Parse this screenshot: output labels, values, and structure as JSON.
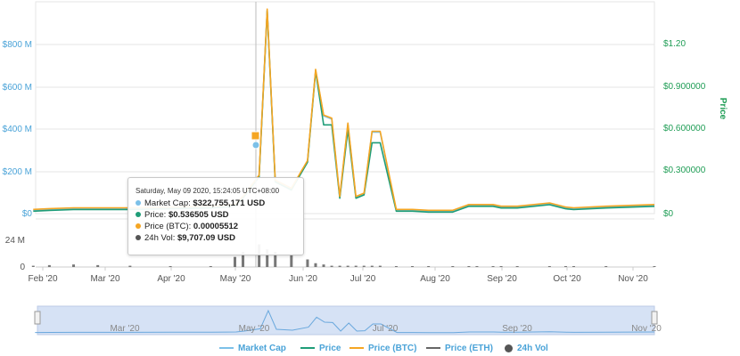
{
  "chart_data": {
    "type": "line",
    "title": "",
    "y_left": {
      "ticks": [
        "$0",
        "$200 M",
        "$400 M",
        "$600 M",
        "$800 M"
      ],
      "values": [
        0,
        200000000,
        400000000,
        600000000,
        800000000
      ]
    },
    "y_right": {
      "label": "Price",
      "ticks": [
        "$0",
        "$0.300000",
        "$0.600000",
        "$0.900000",
        "$1.20"
      ],
      "values": [
        0,
        0.3,
        0.6,
        0.9,
        1.2
      ]
    },
    "y_volume": {
      "ticks": [
        "0",
        "24 M"
      ],
      "values": [
        0,
        24000000
      ]
    },
    "x_ticks": [
      "Feb '20",
      "Mar '20",
      "Apr '20",
      "May '20",
      "Jun '20",
      "Jul '20",
      "Aug '20",
      "Sep '20",
      "Oct '20",
      "Nov '20"
    ],
    "navigator_ticks": [
      "Mar '20",
      "May '20",
      "Jul '20",
      "Sep '20",
      "Nov '20"
    ],
    "grid": true,
    "legend_position": "bottom",
    "colors": {
      "market_cap": "#7cc0e8",
      "price": "#1f9d78",
      "price_btc": "#f5a623",
      "price_eth": "#666666",
      "volume": "#555555"
    },
    "x": [
      2020.08,
      2020.1,
      2020.13,
      2020.16,
      2020.2,
      2020.25,
      2020.3,
      2020.33,
      2020.34,
      2020.36,
      2020.37,
      2020.38,
      2020.4,
      2020.42,
      2020.43,
      2020.44,
      2020.45,
      2020.46,
      2020.47,
      2020.48,
      2020.49,
      2020.5,
      2020.51,
      2020.53,
      2020.55,
      2020.57,
      2020.6,
      2020.62,
      2020.63,
      2020.65,
      2020.66,
      2020.68,
      2020.72,
      2020.74,
      2020.75,
      2020.79,
      2020.85
    ],
    "series": [
      {
        "name": "Market Cap",
        "values": [
          0.02,
          0.025,
          0.03,
          0.03,
          0.03,
          0.035,
          0.04,
          0.05,
          0.1,
          0.23,
          1.25,
          0.2,
          0.15,
          0.32,
          0.88,
          0.6,
          0.58,
          0.1,
          0.55,
          0.1,
          0.12,
          0.5,
          0.5,
          0.02,
          0.02,
          0.015,
          0.015,
          0.05,
          0.05,
          0.05,
          0.04,
          0.04,
          0.06,
          0.035,
          0.03,
          0.04,
          0.05
        ]
      },
      {
        "name": "Price",
        "values": [
          0.02,
          0.025,
          0.03,
          0.03,
          0.03,
          0.035,
          0.04,
          0.05,
          0.1,
          0.23,
          1.25,
          0.2,
          0.15,
          0.32,
          0.88,
          0.55,
          0.55,
          0.1,
          0.52,
          0.1,
          0.12,
          0.44,
          0.44,
          0.02,
          0.02,
          0.015,
          0.015,
          0.05,
          0.05,
          0.05,
          0.04,
          0.04,
          0.06,
          0.035,
          0.03,
          0.04,
          0.05
        ]
      },
      {
        "name": "Price (BTC)",
        "values": [
          0.02,
          0.025,
          0.03,
          0.03,
          0.03,
          0.035,
          0.04,
          0.05,
          0.1,
          0.23,
          1.25,
          0.2,
          0.15,
          0.32,
          0.88,
          0.6,
          0.58,
          0.1,
          0.55,
          0.1,
          0.12,
          0.5,
          0.5,
          0.02,
          0.02,
          0.015,
          0.015,
          0.05,
          0.05,
          0.05,
          0.04,
          0.04,
          0.06,
          0.035,
          0.03,
          0.04,
          0.05
        ]
      },
      {
        "name": "Price (ETH)",
        "values": []
      },
      {
        "name": "24h Vol",
        "values": [
          1,
          1.5,
          2,
          1.5,
          1,
          0.5,
          0.5,
          8,
          12,
          18,
          14,
          12,
          10,
          6,
          3,
          2,
          1,
          1,
          1,
          1,
          1,
          1,
          1,
          0.5,
          0.5,
          0.5,
          0.5,
          0.5,
          0.5,
          0.5,
          0.5,
          0.5,
          0.5,
          0.5,
          0.5,
          0.5,
          0.5
        ]
      }
    ],
    "tooltip": {
      "header": "Saturday, May 09 2020, 15:24:05 UTC+08:00",
      "rows": [
        {
          "label": "Market Cap: ",
          "value": "$322,755,171 USD",
          "color": "#7cc0e8"
        },
        {
          "label": "Price: ",
          "value": "$0.536505 USD",
          "color": "#1f9d78"
        },
        {
          "label": "Price (BTC): ",
          "value": "0.00005512",
          "color": "#f5a623"
        },
        {
          "label": "24h Vol: ",
          "value": "$9,707.09 USD",
          "color": "#555555"
        }
      ]
    }
  },
  "legend": [
    {
      "label": "Market Cap",
      "kind": "line",
      "color": "#7cc0e8"
    },
    {
      "label": "Price",
      "kind": "line",
      "color": "#1f9d78"
    },
    {
      "label": "Price (BTC)",
      "kind": "line",
      "color": "#f5a623"
    },
    {
      "label": "Price (ETH)",
      "kind": "line",
      "color": "#666666"
    },
    {
      "label": "24h Vol",
      "kind": "dot",
      "color": "#555555"
    }
  ]
}
